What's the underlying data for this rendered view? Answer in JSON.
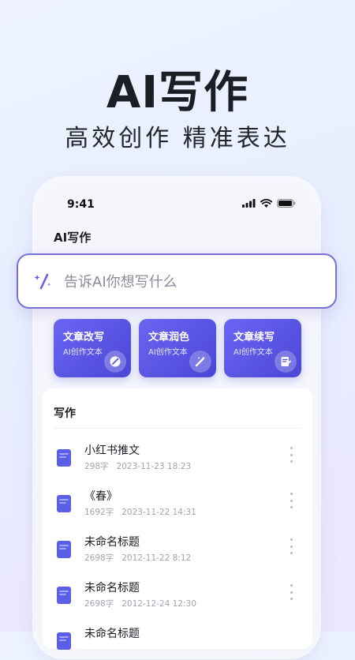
{
  "hero": {
    "title": "AI写作",
    "subtitle": "高效创作 精准表达"
  },
  "status_bar": {
    "time": "9:41"
  },
  "app": {
    "title": "AI写作"
  },
  "search": {
    "placeholder": "告诉AI你想写什么"
  },
  "features": [
    {
      "title": "文章改写",
      "subtitle": "AI创作文本",
      "icon": "edit-icon"
    },
    {
      "title": "文章润色",
      "subtitle": "AI创作文本",
      "icon": "magic-wand-icon"
    },
    {
      "title": "文章续写",
      "subtitle": "AI创作文本",
      "icon": "write-doc-icon"
    }
  ],
  "section": {
    "title": "写作"
  },
  "documents": [
    {
      "name": "小红书推文",
      "words": "298字",
      "date": "2023-11-23 18:23"
    },
    {
      "name": "《春》",
      "words": "1692字",
      "date": "2023-11-22 14:31"
    },
    {
      "name": "未命名标题",
      "words": "2698字",
      "date": "2012-11-22 8:12"
    },
    {
      "name": "未命名标题",
      "words": "2698字",
      "date": "2012-12-24 12:30"
    },
    {
      "name": "未命名标题",
      "words": "",
      "date": ""
    }
  ],
  "colors": {
    "accent": "#5753e3",
    "search_border": "#7a6fd8",
    "doc_icon": "#5a5fe6"
  }
}
